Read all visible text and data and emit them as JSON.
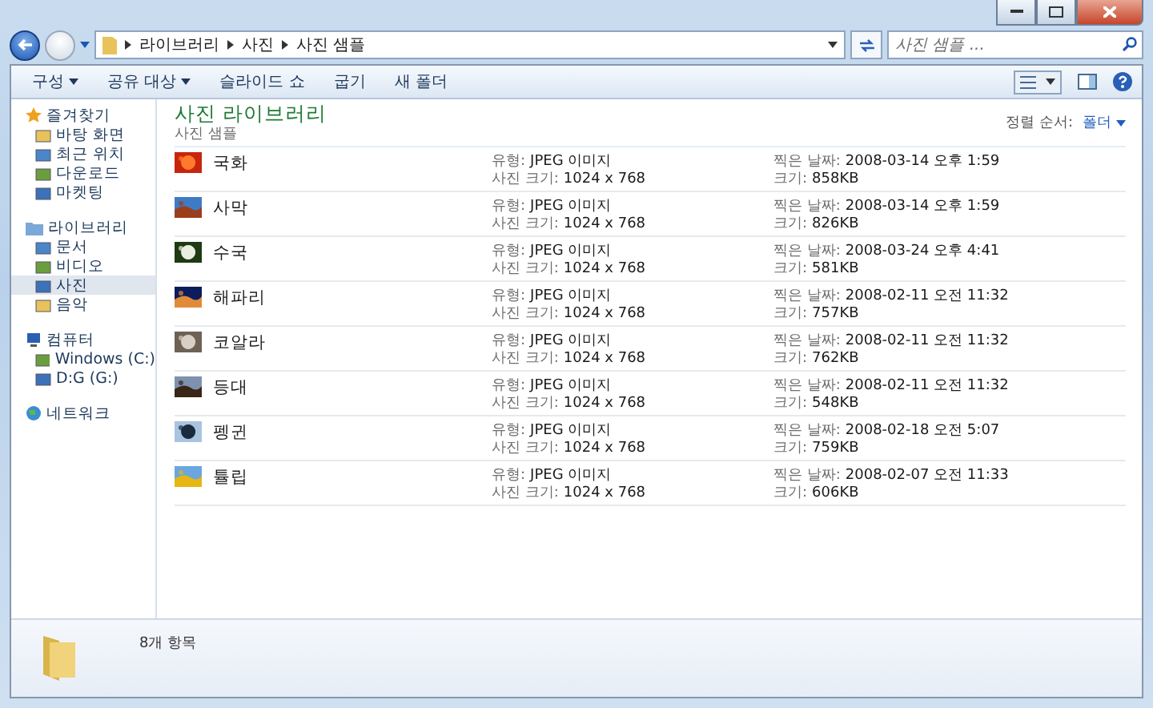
{
  "address": {
    "segments": [
      "라이브러리",
      "사진",
      "사진 샘플"
    ]
  },
  "search": {
    "placeholder": "사진 샘플 ..."
  },
  "toolbar": [
    {
      "label": "구성",
      "menu": true
    },
    {
      "label": "공유 대상",
      "menu": true
    },
    {
      "label": "슬라이드 쇼",
      "menu": false
    },
    {
      "label": "굽기",
      "menu": false
    },
    {
      "label": "새 폴더",
      "menu": false
    }
  ],
  "sidebar": [
    {
      "label": "즐겨찾기",
      "children": [
        {
          "label": "바탕 화면",
          "selected": false
        },
        {
          "label": "최근 위치",
          "selected": false
        },
        {
          "label": "다운로드",
          "selected": false
        },
        {
          "label": "마켓팅",
          "selected": false
        }
      ]
    },
    {
      "label": "라이브러리",
      "children": [
        {
          "label": "문서",
          "selected": false
        },
        {
          "label": "비디오",
          "selected": false
        },
        {
          "label": "사진",
          "selected": true
        },
        {
          "label": "음악",
          "selected": false
        }
      ]
    },
    {
      "label": "컴퓨터",
      "children": [
        {
          "label": "Windows  (C:)",
          "selected": false
        },
        {
          "label": "D:G (G:)",
          "selected": false
        }
      ]
    },
    {
      "label": "네트워크"
    }
  ],
  "header": {
    "title": "사진 라이브러리",
    "subtitle": "사진 샘플",
    "arrange_label": "정렬 순서:",
    "arrange_value": "폴더"
  },
  "files": [
    {
      "name": "국화",
      "info": [
        {
          "label": "유형:",
          "value": "JPEG 이미지"
        },
        {
          "label": "사진 크기:",
          "value": "1024 x 768"
        }
      ],
      "meta": [
        {
          "label": "찍은 날짜:",
          "value": "2008-03-14 오후 1:59"
        },
        {
          "label": "크기:",
          "value": "858KB"
        }
      ]
    },
    {
      "name": "사막",
      "info": [
        {
          "label": "유형:",
          "value": "JPEG 이미지"
        },
        {
          "label": "사진 크기:",
          "value": "1024 x 768"
        }
      ],
      "meta": [
        {
          "label": "찍은 날짜:",
          "value": "2008-03-14 오후 1:59"
        },
        {
          "label": "크기:",
          "value": "826KB"
        }
      ]
    },
    {
      "name": "수국",
      "info": [
        {
          "label": "유형:",
          "value": "JPEG 이미지"
        },
        {
          "label": "사진 크기:",
          "value": "1024 x 768"
        }
      ],
      "meta": [
        {
          "label": "찍은 날짜:",
          "value": "2008-03-24 오후 4:41"
        },
        {
          "label": "크기:",
          "value": "581KB"
        }
      ]
    },
    {
      "name": "해파리",
      "info": [
        {
          "label": "유형:",
          "value": "JPEG 이미지"
        },
        {
          "label": "사진 크기:",
          "value": "1024 x 768"
        }
      ],
      "meta": [
        {
          "label": "찍은 날짜:",
          "value": "2008-02-11 오전 11:32"
        },
        {
          "label": "크기:",
          "value": "757KB"
        }
      ]
    },
    {
      "name": "코알라",
      "info": [
        {
          "label": "유형:",
          "value": "JPEG 이미지"
        },
        {
          "label": "사진 크기:",
          "value": "1024 x 768"
        }
      ],
      "meta": [
        {
          "label": "찍은 날짜:",
          "value": "2008-02-11 오전 11:32"
        },
        {
          "label": "크기:",
          "value": "762KB"
        }
      ]
    },
    {
      "name": "등대",
      "info": [
        {
          "label": "유형:",
          "value": "JPEG 이미지"
        },
        {
          "label": "사진 크기:",
          "value": "1024 x 768"
        }
      ],
      "meta": [
        {
          "label": "찍은 날짜:",
          "value": "2008-02-11 오전 11:32"
        },
        {
          "label": "크기:",
          "value": "548KB"
        }
      ]
    },
    {
      "name": "펭귄",
      "info": [
        {
          "label": "유형:",
          "value": "JPEG 이미지"
        },
        {
          "label": "사진 크기:",
          "value": "1024 x 768"
        }
      ],
      "meta": [
        {
          "label": "찍은 날짜:",
          "value": "2008-02-18 오전 5:07"
        },
        {
          "label": "크기:",
          "value": "759KB"
        }
      ]
    },
    {
      "name": "튤립",
      "info": [
        {
          "label": "유형:",
          "value": "JPEG 이미지"
        },
        {
          "label": "사진 크기:",
          "value": "1024 x 768"
        }
      ],
      "meta": [
        {
          "label": "찍은 날짜:",
          "value": "2008-02-07 오전 11:33"
        },
        {
          "label": "크기:",
          "value": "606KB"
        }
      ]
    }
  ],
  "status": {
    "count": "8개 항목"
  }
}
